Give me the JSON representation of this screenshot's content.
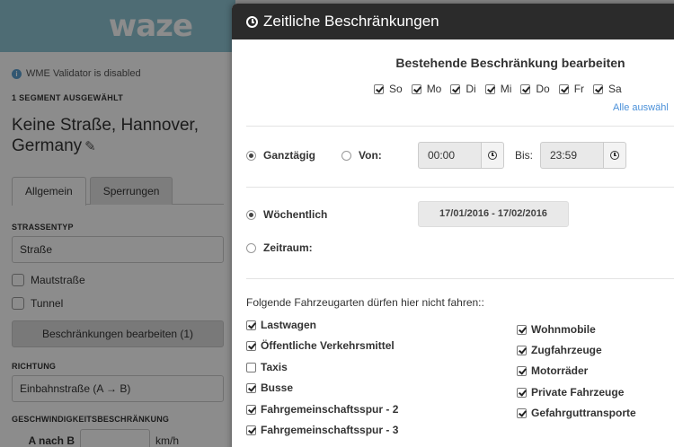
{
  "sidebar": {
    "logo": "waze",
    "validator_text": "WME Validator is disabled",
    "selection_count": "1 SEGMENT AUSGEWÄHLT",
    "street_name_line1": "Keine Straße, Hannover,",
    "street_name_line2": "Germany",
    "tabs": [
      {
        "label": "Allgemein",
        "active": true
      },
      {
        "label": "Sperrungen",
        "active": false
      }
    ],
    "road_type_label": "STRASSENTYP",
    "road_type_value": "Straße",
    "toll_label": "Mautstraße",
    "tunnel_label": "Tunnel",
    "restrictions_button": "Beschränkungen bearbeiten (1)",
    "direction_label": "RICHTUNG",
    "direction_value": "Einbahnstraße (A → B)",
    "speed_label": "GESCHWINDIGKEITSBESCHRÄNKUNG",
    "speed_a_to_b_label": "A nach B",
    "speed_value": "",
    "speed_unit": "km/h"
  },
  "modal": {
    "title": "Zeitliche Beschränkungen",
    "edit_heading": "Bestehende Beschränkung bearbeiten",
    "days": [
      {
        "label": "So",
        "checked": true
      },
      {
        "label": "Mo",
        "checked": true
      },
      {
        "label": "Di",
        "checked": true
      },
      {
        "label": "Mi",
        "checked": true
      },
      {
        "label": "Do",
        "checked": true
      },
      {
        "label": "Fr",
        "checked": true
      },
      {
        "label": "Sa",
        "checked": true
      }
    ],
    "select_all": "Alle auswähl",
    "all_day_label": "Ganztägig",
    "all_day_selected": true,
    "from_label": "Von:",
    "from_selected": false,
    "from_time": "00:00",
    "to_label": "Bis:",
    "to_time": "23:59",
    "weekly_label": "Wöchentlich",
    "weekly_selected": true,
    "date_range": "17/01/2016 - 17/02/2016",
    "period_label": "Zeitraum:",
    "period_selected": false,
    "vehicles_heading": "Folgende Fahrzeugarten dürfen hier nicht fahren::",
    "vehicles_left": [
      {
        "label": "Lastwagen",
        "checked": true
      },
      {
        "label": "Öffentliche Verkehrsmittel",
        "checked": true
      },
      {
        "label": "Taxis",
        "checked": false
      },
      {
        "label": "Busse",
        "checked": true
      },
      {
        "label": "Fahrgemeinschaftsspur - 2",
        "checked": true
      },
      {
        "label": "Fahrgemeinschaftsspur - 3",
        "checked": true
      }
    ],
    "vehicles_right": [
      {
        "label": "Wohnmobile",
        "checked": true
      },
      {
        "label": "Zugfahrzeuge",
        "checked": true
      },
      {
        "label": "Motorräder",
        "checked": true
      },
      {
        "label": "Private Fahrzeuge",
        "checked": true
      },
      {
        "label": "Gefahrguttransporte",
        "checked": true
      }
    ]
  }
}
